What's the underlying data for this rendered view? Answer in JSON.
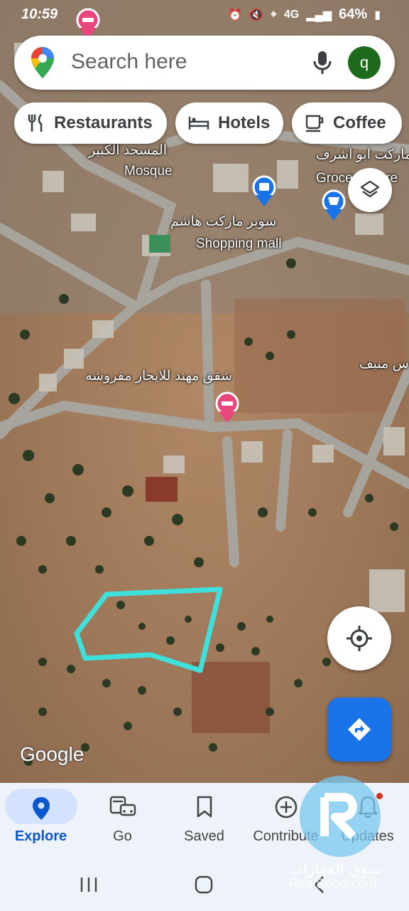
{
  "status_bar": {
    "time": "10:59",
    "network": "4G",
    "battery": "64%"
  },
  "search": {
    "placeholder": "Search here",
    "avatar_letter": "q"
  },
  "chips": [
    {
      "label": "Restaurants",
      "icon": "fork-knife-icon"
    },
    {
      "label": "Hotels",
      "icon": "bed-icon"
    },
    {
      "label": "Coffee",
      "icon": "coffee-cup-icon"
    }
  ],
  "map_labels": {
    "mosque_arabic": "المسجد الكبير",
    "mosque": "Mosque",
    "market_arabic": "ماركت ابو اشرف",
    "grocery": "Grocery store",
    "supermarket_arabic": "سوبر ماركت هاشم",
    "shopping_mall": "Shopping mall",
    "apartments_arabic": "شقق مهند للايجار مفروشه",
    "right_arabic": "س منيف"
  },
  "google_logo": "Google",
  "bottom_nav": [
    {
      "label": "Explore",
      "icon": "location-pin-icon",
      "active": true
    },
    {
      "label": "Go",
      "icon": "car-transit-icon",
      "active": false
    },
    {
      "label": "Saved",
      "icon": "bookmark-icon",
      "active": false
    },
    {
      "label": "Contribute",
      "icon": "add-circle-icon",
      "active": false
    },
    {
      "label": "Updates",
      "icon": "bell-icon",
      "active": false
    }
  ],
  "watermark": {
    "arabic": "سوق العقارات",
    "latin": "RealSooq.com"
  },
  "colors": {
    "accent_blue": "#1a73e8",
    "highlight_cyan": "#3fe0dc",
    "avatar_green": "#1e6b1e"
  }
}
